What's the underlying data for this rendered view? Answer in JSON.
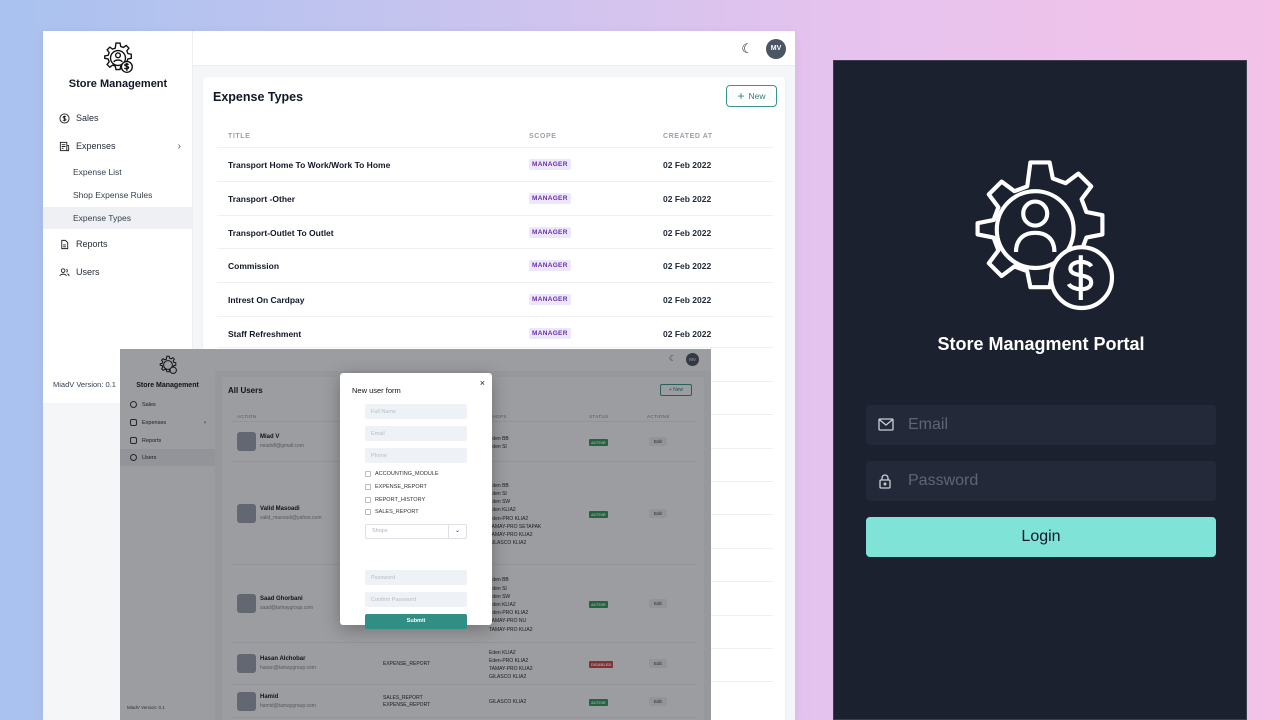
{
  "main_window": {
    "brand": "Store Management",
    "nav": {
      "sales": "Sales",
      "expenses": "Expenses",
      "expense_list": "Expense List",
      "shop_expense_rules": "Shop Expense Rules",
      "expense_types": "Expense Types",
      "reports": "Reports",
      "users": "Users"
    },
    "version": "MiadV Version: 0.1",
    "user_initials": "MV",
    "card": {
      "title": "Expense Types",
      "new_label": "New",
      "columns": [
        "TITLE",
        "SCOPE",
        "CREATED AT"
      ],
      "rows": [
        {
          "title": "Transport Home To Work/Work To Home",
          "scope": "MANAGER",
          "date": "02 Feb 2022"
        },
        {
          "title": "Transport -Other",
          "scope": "MANAGER",
          "date": "02 Feb 2022"
        },
        {
          "title": "Transport-Outlet To Outlet",
          "scope": "MANAGER",
          "date": "02 Feb 2022"
        },
        {
          "title": "Commission",
          "scope": "MANAGER",
          "date": "02 Feb 2022"
        },
        {
          "title": "Intrest On Cardpay",
          "scope": "MANAGER",
          "date": "02 Feb 2022"
        },
        {
          "title": "Staff Refreshment",
          "scope": "MANAGER",
          "date": "02 Feb 2022"
        }
      ],
      "partial_dates": [
        "2",
        "2",
        "2",
        "2",
        "2",
        "2",
        "2",
        "2",
        "2",
        "2",
        "2"
      ]
    }
  },
  "users_window": {
    "brand": "Store Management",
    "nav": {
      "sales": "Sales",
      "expenses": "Expenses",
      "reports": "Reports",
      "users": "Users"
    },
    "version": "MiadV Version: 0.1",
    "user_initials": "MV",
    "title": "All Users",
    "new_label": "+ New",
    "columns": {
      "action": "ACTION",
      "shops": "SHOPS",
      "status": "STATUS",
      "actions": "ACTIONS"
    },
    "users": [
      {
        "name": "Miad V",
        "email": "miadv8@gmail.com",
        "permissions": "",
        "shops": "Eden BB\nEden SI",
        "status": "ACTIVE",
        "edit": "Edit"
      },
      {
        "name": "Valid Masoadi",
        "email": "valid_masoadi@yahoo.com",
        "permissions": "",
        "shops": "Eden BB\nEden SI\nEden SW\nEden KLIA2\nEden-PRO KLIA2\nTAMAY-PRO SETAPAK\nTAMAY-PRO KLIA2\nGILASCO KLIA2",
        "status": "ACTIVE",
        "edit": "Edit"
      },
      {
        "name": "Saad Ghorbani",
        "email": "saad@tamaygroup.com",
        "permissions": "",
        "shops": "Eden BB\nEden SI\nEden SW\nEden KLIA2\nEden-PRO KLIA2\nTAMAY-PRO NU\nTAMAY-PRO KLIA2",
        "status": "ACTIVE",
        "edit": "Edit"
      },
      {
        "name": "Hasan Alchobar",
        "email": "hasan@tamaygroup.com",
        "permissions": "EXPENSE_REPORT",
        "shops": "Eden KLIA2\nEden-PRO KLIA2\nTAMAY-PRO KLIA2\nGILASCO KLIA2",
        "status": "DISABLED",
        "edit": "Edit"
      },
      {
        "name": "Hamid",
        "email": "hamid@tamaygroup.com",
        "permissions": "SALES_REPORT\nEXPENSE_REPORT",
        "shops": "GILASCO KLIA2",
        "status": "ACTIVE",
        "edit": "Edit"
      },
      {
        "name": "",
        "email": "",
        "permissions": "",
        "shops": "Eden BB\nEden SI",
        "status": "",
        "edit": ""
      }
    ],
    "modal": {
      "title": "New user form",
      "close": "×",
      "full_name_placeholder": "Full Name",
      "email_placeholder": "Email",
      "phone_placeholder": "Phone",
      "checks": [
        "ACCOUNTING_MODULE",
        "EXPENSE_REPORT",
        "REPORT_HISTORY",
        "SALES_REPORT"
      ],
      "shops_placeholder": "Shops",
      "password_placeholder": "Password",
      "confirm_password_placeholder": "Confirm Password",
      "submit": "Submit"
    }
  },
  "login": {
    "title": "Store Managment Portal",
    "email_placeholder": "Email",
    "password_placeholder": "Password",
    "button": "Login"
  },
  "colors": {
    "accent": "#2f8f85",
    "login_button": "#7fe3d8",
    "login_bg": "#1c2130",
    "badge_bg": "#ede7fb",
    "badge_text": "#6b2fb0",
    "active": "#2f9e57",
    "disabled": "#d64545"
  }
}
